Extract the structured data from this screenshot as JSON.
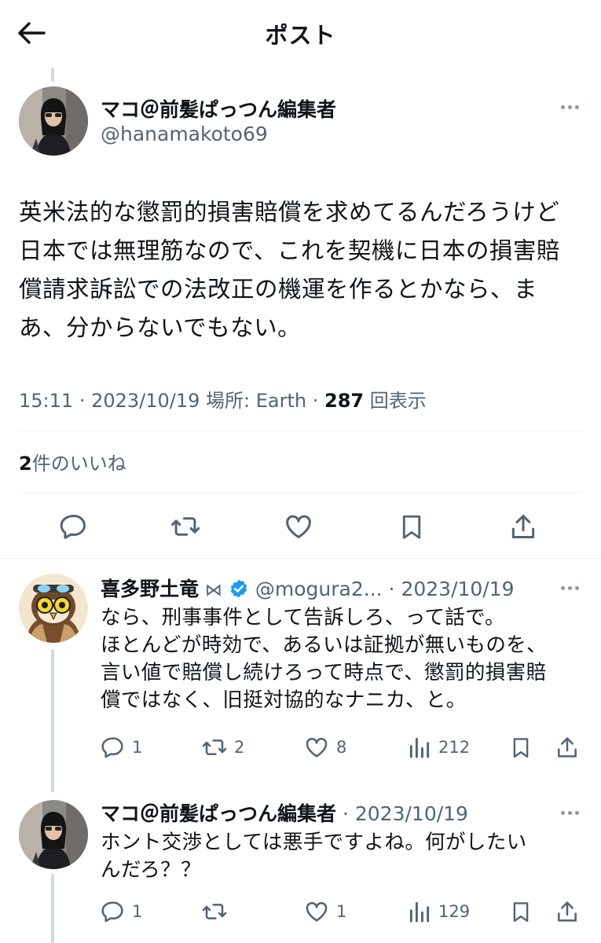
{
  "header": {
    "title": "ポスト"
  },
  "main_post": {
    "display_name": "マコ＠前髪ぱっつん編集者",
    "handle": "@hanamakoto69",
    "text_lines": [
      "英米法的な懲罰的損害賠償を求めてるんだろうけど",
      "日本では無理筋なので、これを契機に日本の損害賠",
      "償請求訴訟での法改正の機運を作るとかなら、ま",
      "あ、分からないでもない。"
    ],
    "time": "15:11",
    "date": "2023/10/19",
    "location": "場所: Earth",
    "views_count": "287",
    "views_label": "回表示",
    "likes_count": "2",
    "likes_label": "件のいいね"
  },
  "replies": [
    {
      "display_name": "喜多野土竜",
      "badge_glyph": "⋈",
      "handle": "@mogura2...",
      "date": "2023/10/19",
      "text_lines": [
        "なら、刑事事件として告訴しろ、って話で。",
        "ほとんどが時効で、あるいは証拠が無いものを、",
        "言い値で賠償し続けろって時点で、懲罰的損害賠",
        "償ではなく、旧挺対協的なナニカ、と。"
      ],
      "replies": "1",
      "reposts": "2",
      "likes": "8",
      "views": "212"
    },
    {
      "display_name": "マコ＠前髪ぱっつん編集者",
      "date": "2023/10/19",
      "text_lines": [
        "ホント交渉としては悪手ですよね。何がしたい",
        "んだろ？？"
      ],
      "replies": "1",
      "likes": "1",
      "views": "129"
    }
  ],
  "colors": {
    "text": "#0f1419",
    "muted": "#536471",
    "verified": "#1d9bf0",
    "divider": "#eff3f4",
    "thread_line": "#cfd9de"
  },
  "icons": [
    "back-arrow-icon",
    "more-icon",
    "reply-icon",
    "repost-icon",
    "like-icon",
    "bookmark-icon",
    "share-icon",
    "views-icon",
    "verified-badge-icon"
  ]
}
